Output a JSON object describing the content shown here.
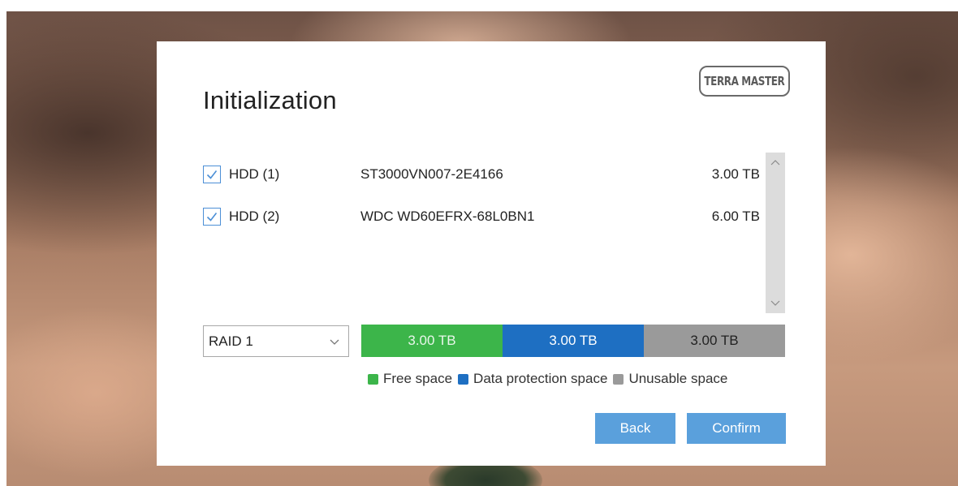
{
  "dialog": {
    "title": "Initialization",
    "logo_text": "TERRA MASTER"
  },
  "disks": [
    {
      "name": "HDD (1)",
      "model": "ST3000VN007-2E4166",
      "size": "3.00 TB",
      "checked": true
    },
    {
      "name": "HDD (2)",
      "model": "WDC WD60EFRX-68L0BN1",
      "size": "6.00 TB",
      "checked": true
    }
  ],
  "raid": {
    "selected": "RAID 1"
  },
  "capacity": {
    "free": {
      "label": "3.00 TB",
      "color": "#3cb54a"
    },
    "protection": {
      "label": "3.00 TB",
      "color": "#1e6fc2"
    },
    "unusable": {
      "label": "3.00 TB",
      "color": "#9a9a9a"
    }
  },
  "legend": {
    "free": "Free space",
    "protection": "Data protection space",
    "unusable": "Unusable space"
  },
  "buttons": {
    "back": "Back",
    "confirm": "Confirm",
    "color": "#5aa0dc"
  },
  "icons": {
    "checkbox": "checkmark-icon",
    "select": "chevron-down-icon",
    "scroll_up": "chevron-up-icon",
    "scroll_down": "chevron-down-icon"
  }
}
